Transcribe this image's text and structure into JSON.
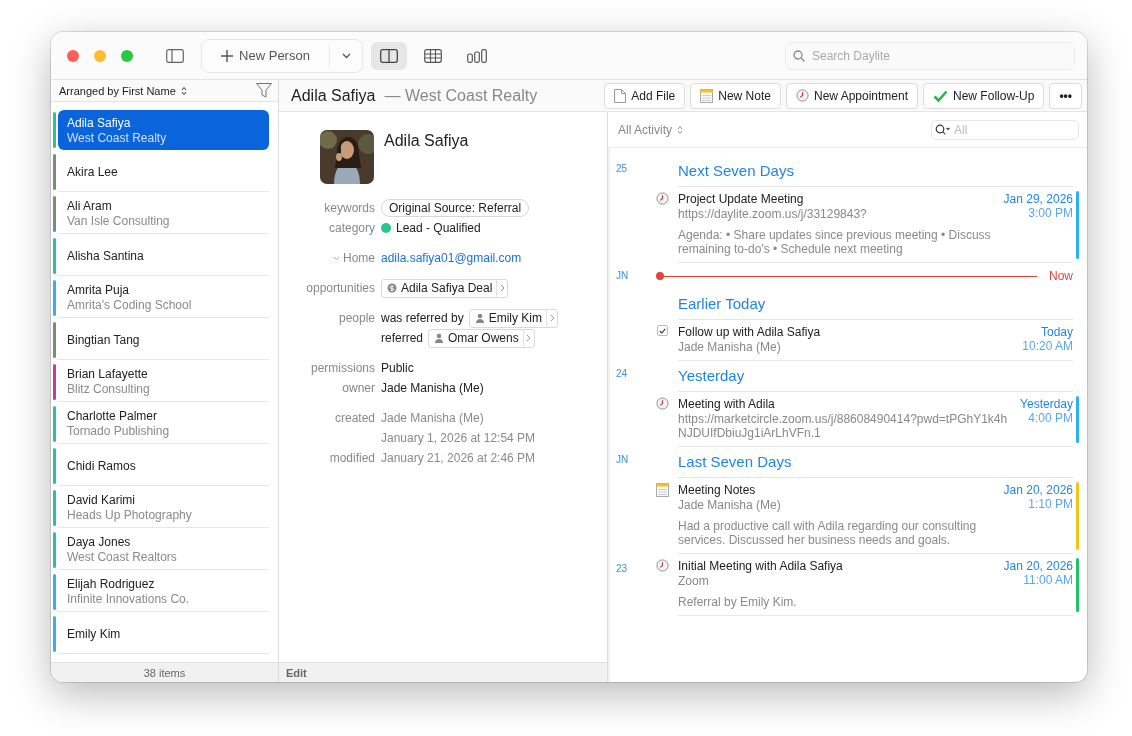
{
  "toolbar": {
    "new_button": {
      "label": "New Person"
    },
    "view_buttons": [
      {
        "kind": "split",
        "selected": true
      },
      {
        "kind": "table",
        "selected": false
      },
      {
        "kind": "columns",
        "selected": false
      }
    ],
    "search": {
      "placeholder": "Search Daylite"
    }
  },
  "sidebar": {
    "sort_label": "Arranged by First Name",
    "items": [
      {
        "name": "Adila Safiya",
        "company": "West Coast Realty",
        "color": "#2bc48a",
        "selected": true
      },
      {
        "name": "Akira Lee",
        "color": "#7a8c7a",
        "selected": false
      },
      {
        "name": "Ali Aram",
        "company": "Van Isle Consulting",
        "color": "#7a8c7a",
        "selected": false
      },
      {
        "name": "Alisha Santina",
        "color": "#2bc48a",
        "selected": false
      },
      {
        "name": "Amrita Puja",
        "company": "Amrita's Coding School",
        "color": "#3aaee8",
        "selected": false
      },
      {
        "name": "Bingtian Tang",
        "color": "#7a8c7a",
        "selected": false
      },
      {
        "name": "Brian Lafayette",
        "company": "Blitz Consulting",
        "color": "#c23aa8",
        "selected": false
      },
      {
        "name": "Charlotte Palmer",
        "company": "Tornado Publishing",
        "color": "#2bc48a",
        "selected": false
      },
      {
        "name": "Chidi Ramos",
        "color": "#2bc48a",
        "selected": false
      },
      {
        "name": "David Karimi",
        "company": "Heads Up Photography",
        "color": "#2bc48a",
        "selected": false
      },
      {
        "name": "Daya Jones",
        "company": "West Coast Realtors",
        "color": "#2bc48a",
        "selected": false
      },
      {
        "name": "Elijah Rodriguez",
        "company": "Infinite Innovations Co.",
        "color": "#3aaee8",
        "selected": false
      },
      {
        "name": "Emily Kim",
        "color": "#3aaee8",
        "selected": false
      }
    ],
    "footer": "38 items"
  },
  "header": {
    "name": "Adila Safiya",
    "company": "— West Coast Realty",
    "actions": [
      {
        "kind": "file",
        "label": "Add File"
      },
      {
        "kind": "note",
        "label": "New Note"
      },
      {
        "kind": "appointment",
        "label": "New Appointment"
      },
      {
        "kind": "followup",
        "label": "New Follow-Up"
      },
      {
        "kind": "more",
        "label": "•••"
      }
    ]
  },
  "detail": {
    "name": "Adila Safiya",
    "fields": [
      {
        "kind": "chip",
        "label": "keywords",
        "value": "Original Source: Referral"
      },
      {
        "kind": "category",
        "label": "category",
        "value": "Lead - Qualified",
        "color": "#2bc48a"
      },
      {
        "kind": "link",
        "label": "Home",
        "value": "adila.safiya01@gmail.com"
      },
      {
        "kind": "opportunity",
        "label": "opportunities",
        "value": "Adila Safiya Deal"
      },
      {
        "kind": "people",
        "label": "people",
        "entries": [
          {
            "relation": "was referred by",
            "name": "Emily Kim"
          },
          {
            "relation": "referred",
            "name": "Omar Owens"
          }
        ]
      },
      {
        "kind": "text",
        "label": "permissions",
        "values": [
          "Public"
        ]
      },
      {
        "kind": "text",
        "label": "owner",
        "values": [
          "Jade Manisha (Me)"
        ]
      },
      {
        "kind": "muted",
        "label": "created",
        "values": [
          "Jade Manisha (Me)",
          "January 1, 2026 at 12:54 PM"
        ]
      },
      {
        "kind": "muted",
        "label": "modified",
        "values": [
          "January 21, 2026 at 2:46 PM"
        ]
      }
    ],
    "footer": "Edit"
  },
  "activity": {
    "filter": "All Activity",
    "search": {
      "placeholder": "All"
    },
    "timeline": [
      {
        "kind": "section",
        "gutter": "25",
        "title": "Next Seven Days"
      },
      {
        "kind": "appointment",
        "title": "Project Update Meeting",
        "subtitle": "https://daylite.zoom.us/j/33129843?",
        "body": "Agenda: • Share updates since previous meeting • Discuss remaining to-do's • Schedule next meeting",
        "date": "Jan 29, 2026",
        "time": "3:00 PM",
        "color": "#2fb0ee"
      },
      {
        "kind": "now",
        "gutter": "JN",
        "title": "Now"
      },
      {
        "kind": "section",
        "title": "Earlier Today"
      },
      {
        "kind": "task",
        "checked": true,
        "title": "Follow up with Adila Safiya",
        "subtitle": "Jade Manisha (Me)",
        "date": "Today",
        "time": "10:20 AM"
      },
      {
        "kind": "section",
        "gutter": "24",
        "title": "Yesterday"
      },
      {
        "kind": "appointment",
        "title": "Meeting with Adila",
        "subtitle": "https://marketcircle.zoom.us/j/88608490414?pwd=tPGhY1k4hNJDUIfDbiuJg1iArLhVFn.1",
        "date": "Yesterday",
        "time": "4:00 PM",
        "color": "#2fb0ee"
      },
      {
        "kind": "section",
        "gutter": "JN",
        "title": "Last Seven Days"
      },
      {
        "kind": "note",
        "title": "Meeting Notes",
        "subtitle": "Jade Manisha (Me)",
        "body": "Had a productive call with Adila regarding our consulting services. Discussed her business needs and goals.",
        "date": "Jan 20, 2026",
        "time": "1:10 PM",
        "color": "#f0c419"
      },
      {
        "kind": "appointment",
        "gutter": "23",
        "title": "Initial Meeting with Adila Safiya",
        "subtitle": "Zoom",
        "body": "Referral by Emily Kim.",
        "date": "Jan 20, 2026",
        "time": "11:00 AM",
        "color": "#22c26a"
      }
    ]
  }
}
